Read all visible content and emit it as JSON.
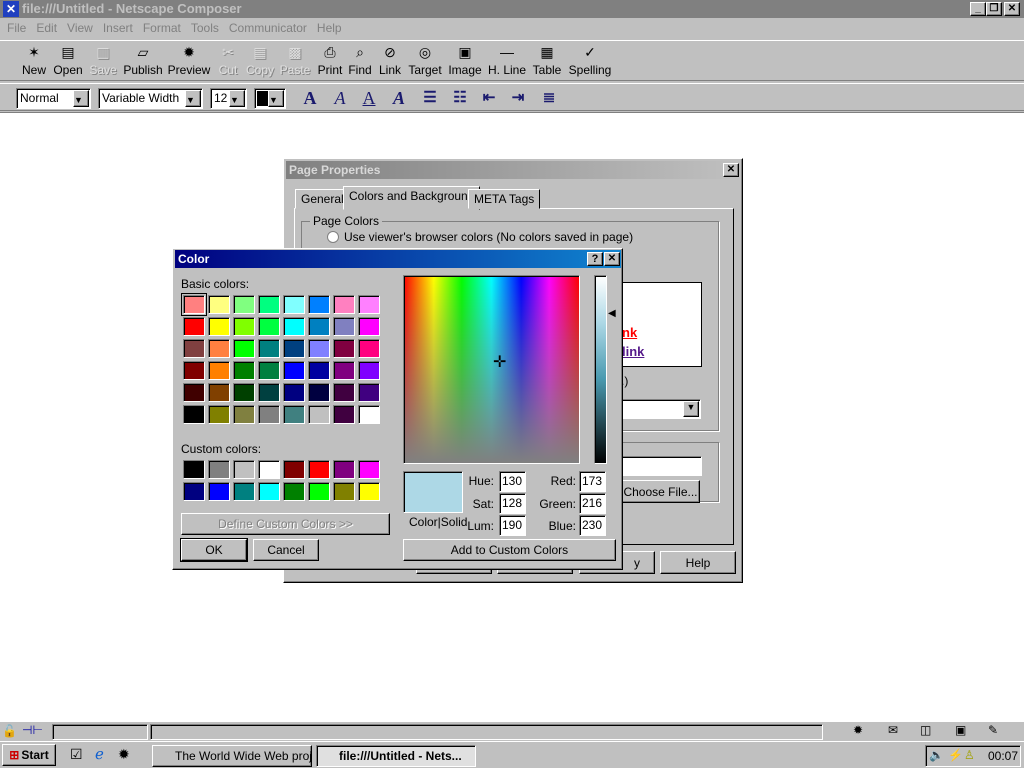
{
  "window": {
    "title": "file:///Untitled - Netscape Composer"
  },
  "menu": [
    "File",
    "Edit",
    "View",
    "Insert",
    "Format",
    "Tools",
    "Communicator",
    "Help"
  ],
  "toolbar": [
    {
      "label": "New",
      "icon": "new-page-icon",
      "glyph": "✶",
      "enabled": true
    },
    {
      "label": "Open",
      "icon": "open-icon",
      "glyph": "▤",
      "enabled": true
    },
    {
      "label": "Save",
      "icon": "save-icon",
      "glyph": "▥",
      "enabled": false
    },
    {
      "label": "Publish",
      "icon": "publish-icon",
      "glyph": "▱",
      "enabled": true
    },
    {
      "label": "Preview",
      "icon": "preview-icon",
      "glyph": "✹",
      "enabled": true
    },
    {
      "label": "Cut",
      "icon": "cut-icon",
      "glyph": "✂",
      "enabled": false
    },
    {
      "label": "Copy",
      "icon": "copy-icon",
      "glyph": "▦",
      "enabled": false
    },
    {
      "label": "Paste",
      "icon": "paste-icon",
      "glyph": "▩",
      "enabled": false
    },
    {
      "label": "Print",
      "icon": "print-icon",
      "glyph": "⎙",
      "enabled": true
    },
    {
      "label": "Find",
      "icon": "find-icon",
      "glyph": "⌕",
      "enabled": true
    },
    {
      "label": "Link",
      "icon": "link-icon",
      "glyph": "⊘",
      "enabled": true
    },
    {
      "label": "Target",
      "icon": "target-icon",
      "glyph": "◎",
      "enabled": true
    },
    {
      "label": "Image",
      "icon": "image-icon",
      "glyph": "▣",
      "enabled": true
    },
    {
      "label": "H. Line",
      "icon": "horizontal-line-icon",
      "glyph": "—",
      "enabled": true
    },
    {
      "label": "Table",
      "icon": "table-icon",
      "glyph": "▦",
      "enabled": true
    },
    {
      "label": "Spelling",
      "icon": "spelling-icon",
      "glyph": "✓",
      "enabled": true
    }
  ],
  "format": {
    "paragraph": "Normal",
    "font": "Variable Width",
    "size": "12",
    "text_color": "#000000"
  },
  "page_properties": {
    "title": "Page Properties",
    "tabs": [
      "General",
      "Colors and Background",
      "META Tags"
    ],
    "active_tab": "Colors and Background",
    "group_label": "Page Colors",
    "radio_label": "Use viewer's browser colors (No colors saved in page)",
    "preview_link": "nk",
    "preview_visited": "link",
    "paren": ".)",
    "choose_file": "Choose File...",
    "help": "Help",
    "apply_partial": "y"
  },
  "color_dialog": {
    "title": "Color",
    "basic_label": "Basic colors:",
    "custom_label": "Custom colors:",
    "basic_colors": [
      "#FF8080",
      "#FFFF80",
      "#80FF80",
      "#00FF80",
      "#80FFFF",
      "#0080FF",
      "#FF80C0",
      "#FF80FF",
      "#FF0000",
      "#FFFF00",
      "#80FF00",
      "#00FF40",
      "#00FFFF",
      "#0080C0",
      "#8080C0",
      "#FF00FF",
      "#804040",
      "#FF8040",
      "#00FF00",
      "#008080",
      "#004080",
      "#8080FF",
      "#800040",
      "#FF0080",
      "#800000",
      "#FF8000",
      "#008000",
      "#008040",
      "#0000FF",
      "#0000A0",
      "#800080",
      "#8000FF",
      "#400000",
      "#804000",
      "#004000",
      "#004040",
      "#000080",
      "#000040",
      "#400040",
      "#400080",
      "#000000",
      "#808000",
      "#808040",
      "#808080",
      "#408080",
      "#C0C0C0",
      "#400040",
      "#FFFFFF"
    ],
    "custom_colors": [
      "#000000",
      "#808080",
      "#C0C0C0",
      "#FFFFFF",
      "#800000",
      "#FF0000",
      "#800080",
      "#FF00FF",
      "#000080",
      "#0000FF",
      "#008080",
      "#00FFFF",
      "#008000",
      "#00FF00",
      "#808000",
      "#FFFF00"
    ],
    "selected_basic": "#FF8080",
    "define_custom": "Define Custom Colors >>",
    "ok": "OK",
    "cancel": "Cancel",
    "color_solid": "Color|Solid",
    "hue_label": "Hue:",
    "sat_label": "Sat:",
    "lum_label": "Lum:",
    "red_label": "Red:",
    "green_label": "Green:",
    "blue_label": "Blue:",
    "hue": "130",
    "sat": "128",
    "lum": "190",
    "red": "173",
    "green": "216",
    "blue": "230",
    "current_color": "#ADD8E6",
    "add_custom": "Add to Custom Colors"
  },
  "taskbar": {
    "start": "Start",
    "tasks": [
      "The World Wide Web proj...",
      "file:///Untitled - Nets..."
    ],
    "clock": "00:07"
  }
}
